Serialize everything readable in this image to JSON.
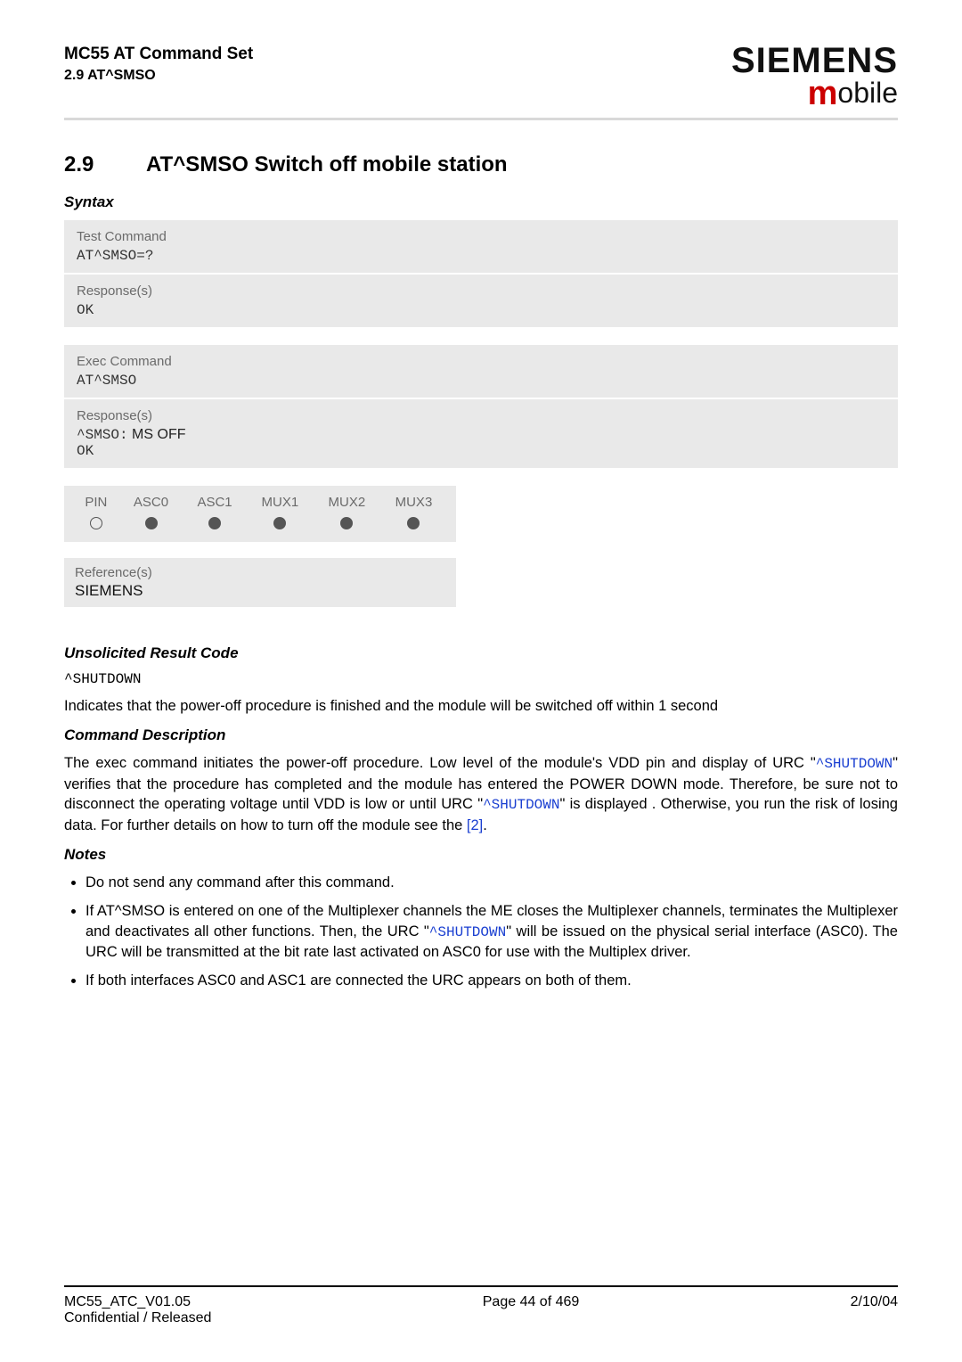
{
  "header": {
    "doc_title": "MC55 AT Command Set",
    "doc_subtitle": "2.9 AT^SMSO",
    "brand_top": "SIEMENS",
    "brand_bottom_m": "m",
    "brand_bottom_rest": "obile"
  },
  "section": {
    "number": "2.9",
    "title": "AT^SMSO   Switch off mobile station"
  },
  "syntax_label": "Syntax",
  "test_cmd": {
    "label": "Test Command",
    "value": "AT^SMSO=?"
  },
  "test_resp": {
    "label": "Response(s)",
    "value": "OK"
  },
  "exec_cmd": {
    "label": "Exec Command",
    "value": "AT^SMSO"
  },
  "exec_resp": {
    "label": "Response(s)",
    "line1_prefix": "^SMSO:",
    "line1_suffix": " MS OFF",
    "line2": "OK"
  },
  "availability": {
    "headers": [
      "PIN",
      "ASC0",
      "ASC1",
      "MUX1",
      "MUX2",
      "MUX3"
    ],
    "states": [
      "empty",
      "filled",
      "filled",
      "filled",
      "filled",
      "filled"
    ]
  },
  "reference": {
    "label": "Reference(s)",
    "value": "SIEMENS"
  },
  "urc_head": "Unsolicited Result Code",
  "urc_code": "^SHUTDOWN",
  "urc_text": "Indicates that the power-off procedure is finished and the module will be switched off within 1 second",
  "cmd_desc_head": "Command Description",
  "cmd_desc": {
    "p1a": "The exec command initiates the power-off procedure. Low level of the module's VDD pin and display of URC \"",
    "p1b": "^SHUTDOWN",
    "p1c": "\" verifies that the procedure has completed and the module has entered the POWER DOWN mode. Therefore, be sure not to disconnect the operating voltage until VDD is low or until URC \"",
    "p1d": "^SHUTDOWN",
    "p1e": "\" is displayed . Otherwise, you run the risk of losing data. For further details on how to turn off the module see the ",
    "ref": "[2]",
    "p1f": "."
  },
  "notes_head": "Notes",
  "notes": {
    "n1": "Do not send any command after this command.",
    "n2a": "If AT^SMSO is entered on one of the Multiplexer channels the ME closes the Multiplexer channels, terminates the Multiplexer and deactivates all other functions. Then, the URC \"",
    "n2b": "^SHUTDOWN",
    "n2c": "\" will be issued on the physical serial interface (ASC0). The URC will be transmitted at the bit rate last activated on ASC0 for use with the Multiplex driver.",
    "n3": "If both interfaces ASC0 and ASC1 are connected the URC appears on both of them."
  },
  "footer": {
    "left1": "MC55_ATC_V01.05",
    "left2": "Confidential / Released",
    "center": "Page 44 of 469",
    "right": "2/10/04"
  }
}
